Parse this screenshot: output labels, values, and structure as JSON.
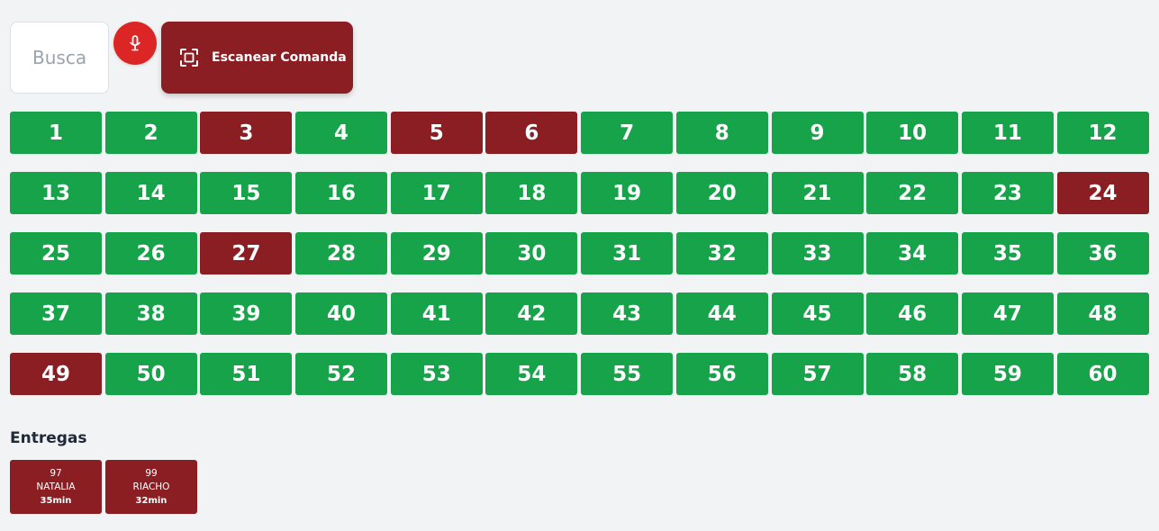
{
  "search": {
    "placeholder": "Busca"
  },
  "mic": {
    "icon": "microphone-icon"
  },
  "scan": {
    "label": "Escanear Comanda",
    "icon": "scan-frame-icon"
  },
  "colors": {
    "free": "#16a34a",
    "occupied": "#8b1e22",
    "mic": "#dc2626",
    "background": "#f2f3f5"
  },
  "tables": [
    {
      "number": "1",
      "status": "free"
    },
    {
      "number": "2",
      "status": "free"
    },
    {
      "number": "3",
      "status": "occupied"
    },
    {
      "number": "4",
      "status": "free"
    },
    {
      "number": "5",
      "status": "occupied"
    },
    {
      "number": "6",
      "status": "occupied"
    },
    {
      "number": "7",
      "status": "free"
    },
    {
      "number": "8",
      "status": "free"
    },
    {
      "number": "9",
      "status": "free"
    },
    {
      "number": "10",
      "status": "free"
    },
    {
      "number": "11",
      "status": "free"
    },
    {
      "number": "12",
      "status": "free"
    },
    {
      "number": "13",
      "status": "free"
    },
    {
      "number": "14",
      "status": "free"
    },
    {
      "number": "15",
      "status": "free"
    },
    {
      "number": "16",
      "status": "free"
    },
    {
      "number": "17",
      "status": "free"
    },
    {
      "number": "18",
      "status": "free"
    },
    {
      "number": "19",
      "status": "free"
    },
    {
      "number": "20",
      "status": "free"
    },
    {
      "number": "21",
      "status": "free"
    },
    {
      "number": "22",
      "status": "free"
    },
    {
      "number": "23",
      "status": "free"
    },
    {
      "number": "24",
      "status": "occupied"
    },
    {
      "number": "25",
      "status": "free"
    },
    {
      "number": "26",
      "status": "free"
    },
    {
      "number": "27",
      "status": "occupied"
    },
    {
      "number": "28",
      "status": "free"
    },
    {
      "number": "29",
      "status": "free"
    },
    {
      "number": "30",
      "status": "free"
    },
    {
      "number": "31",
      "status": "free"
    },
    {
      "number": "32",
      "status": "free"
    },
    {
      "number": "33",
      "status": "free"
    },
    {
      "number": "34",
      "status": "free"
    },
    {
      "number": "35",
      "status": "free"
    },
    {
      "number": "36",
      "status": "free"
    },
    {
      "number": "37",
      "status": "free"
    },
    {
      "number": "38",
      "status": "free"
    },
    {
      "number": "39",
      "status": "free"
    },
    {
      "number": "40",
      "status": "free"
    },
    {
      "number": "41",
      "status": "free"
    },
    {
      "number": "42",
      "status": "free"
    },
    {
      "number": "43",
      "status": "free"
    },
    {
      "number": "44",
      "status": "free"
    },
    {
      "number": "45",
      "status": "free"
    },
    {
      "number": "46",
      "status": "free"
    },
    {
      "number": "47",
      "status": "free"
    },
    {
      "number": "48",
      "status": "free"
    },
    {
      "number": "49",
      "status": "occupied"
    },
    {
      "number": "50",
      "status": "free"
    },
    {
      "number": "51",
      "status": "free"
    },
    {
      "number": "52",
      "status": "free"
    },
    {
      "number": "53",
      "status": "free"
    },
    {
      "number": "54",
      "status": "free"
    },
    {
      "number": "55",
      "status": "free"
    },
    {
      "number": "56",
      "status": "free"
    },
    {
      "number": "57",
      "status": "free"
    },
    {
      "number": "58",
      "status": "free"
    },
    {
      "number": "59",
      "status": "free"
    },
    {
      "number": "60",
      "status": "free"
    }
  ],
  "deliveries": {
    "title": "Entregas",
    "items": [
      {
        "number": "97",
        "name": "NATALIA",
        "time": "35min"
      },
      {
        "number": "99",
        "name": "RIACHO",
        "time": "32min"
      }
    ]
  }
}
